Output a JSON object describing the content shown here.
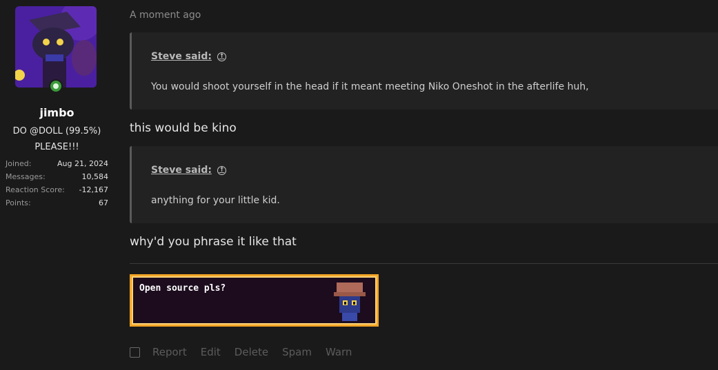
{
  "user": {
    "name": "jimbo",
    "title": "DO @DOLL (99.5%) PLEASE!!!",
    "stats": [
      {
        "label": "Joined:",
        "value": "Aug 21, 2024"
      },
      {
        "label": "Messages:",
        "value": "10,584"
      },
      {
        "label": "Reaction Score:",
        "value": "-12,167"
      },
      {
        "label": "Points:",
        "value": "67"
      }
    ]
  },
  "post": {
    "timestamp": "A moment ago",
    "quote1": {
      "author": "Steve said:",
      "text": "You would shoot yourself in the head if it meant meeting Niko Oneshot in the afterlife huh,"
    },
    "reply1": "this would be kino",
    "quote2": {
      "author": "Steve said:",
      "text": "anything for your little kid."
    },
    "reply2": "why'd you phrase it like that",
    "signature_text": "Open source pls?"
  },
  "actions": {
    "report": "Report",
    "edit": "Edit",
    "delete": "Delete",
    "spam": "Spam",
    "warn": "Warn"
  }
}
